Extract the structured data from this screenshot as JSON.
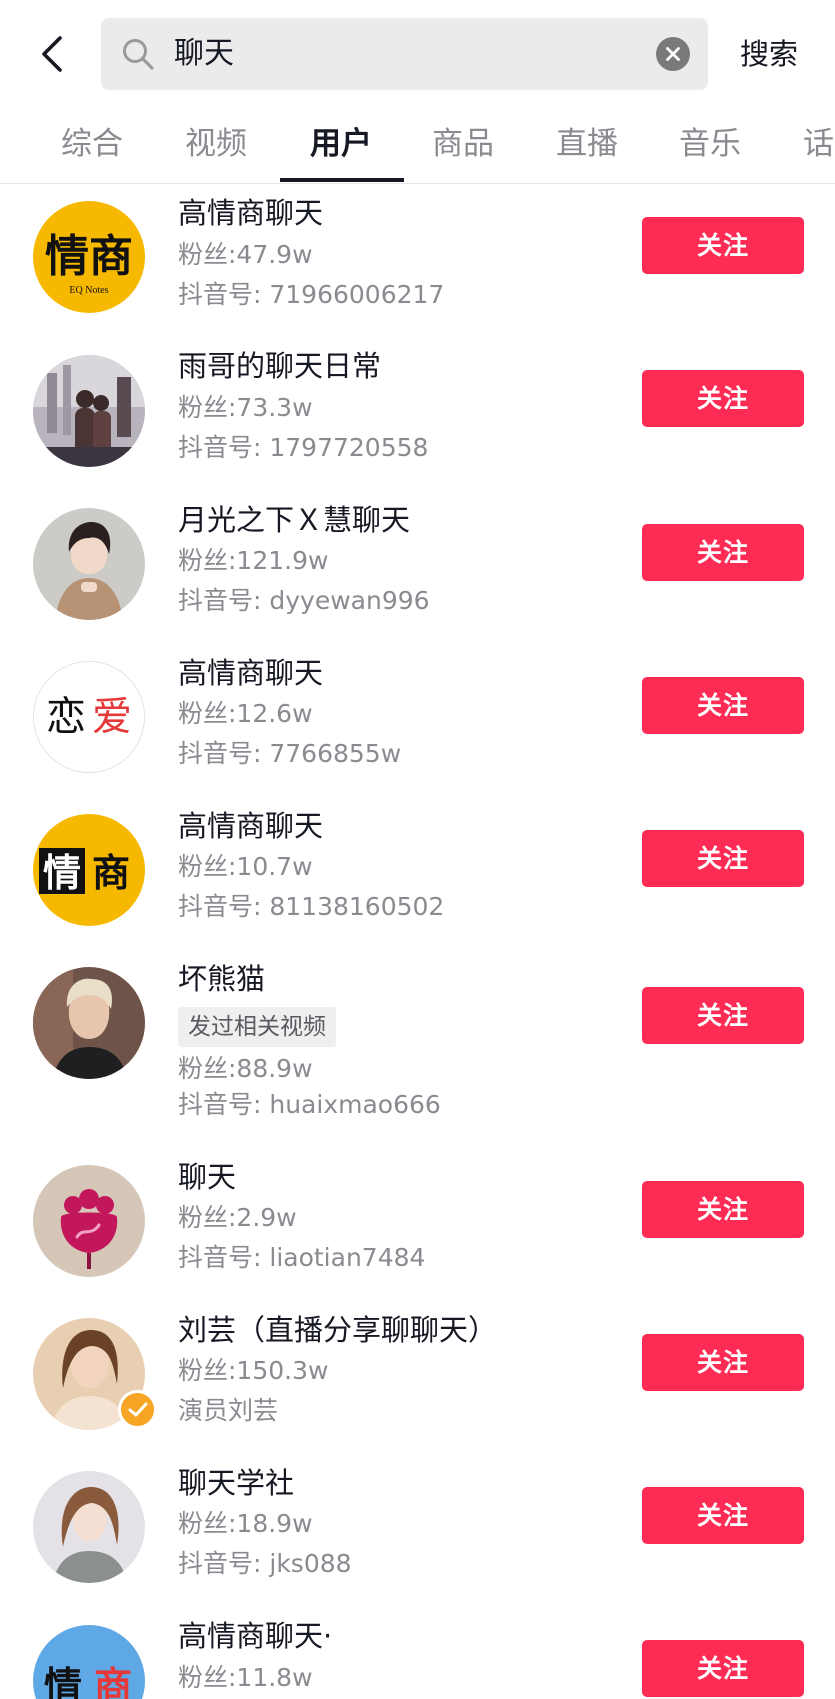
{
  "header": {
    "query": "聊天",
    "search_button": "搜索"
  },
  "tabs": [
    {
      "label": "综合",
      "active": false
    },
    {
      "label": "视频",
      "active": false
    },
    {
      "label": "用户",
      "active": true
    },
    {
      "label": "商品",
      "active": false
    },
    {
      "label": "直播",
      "active": false
    },
    {
      "label": "音乐",
      "active": false
    },
    {
      "label": "话",
      "active": false
    }
  ],
  "users": [
    {
      "name": "高情商聊天",
      "fans": "粉丝:47.9w",
      "id": "抖音号: 71966006217",
      "follow": "关注",
      "avatar_text": "情商",
      "avatar_sub": "EQ Notes"
    },
    {
      "name": "雨哥的聊天日常",
      "fans": "粉丝:73.3w",
      "id": "抖音号: 1797720558",
      "follow": "关注"
    },
    {
      "name": "月光之下Ｘ慧聊天",
      "fans": "粉丝:121.9w",
      "id": "抖音号: dyyewan996",
      "follow": "关注"
    },
    {
      "name": "高情商聊天",
      "fans": "粉丝:12.6w",
      "id": "抖音号: 7766855w",
      "follow": "关注",
      "avatar_text_1": "恋",
      "avatar_text_2": "爱"
    },
    {
      "name": "高情商聊天",
      "fans": "粉丝:10.7w",
      "id": "抖音号: 81138160502",
      "follow": "关注",
      "avatar_text_1": "情",
      "avatar_text_2": "商"
    },
    {
      "name": "坏熊猫",
      "tag": "发过相关视频",
      "fans": "粉丝:88.9w",
      "id": "抖音号: huaixmao666",
      "follow": "关注"
    },
    {
      "name": "聊天",
      "fans": "粉丝:2.9w",
      "id": "抖音号: liaotian7484",
      "follow": "关注"
    },
    {
      "name": "刘芸（直播分享聊聊天）",
      "fans": "粉丝:150.3w",
      "id": "演员刘芸",
      "follow": "关注",
      "verified": true
    },
    {
      "name": "聊天学社",
      "fans": "粉丝:18.9w",
      "id": "抖音号: jks088",
      "follow": "关注"
    },
    {
      "name": "高情商聊天·",
      "fans": "粉丝:11.8w",
      "follow": "关注",
      "avatar_text_1": "情",
      "avatar_text_2": "商"
    }
  ],
  "colors": {
    "accent": "#fe2c55",
    "primary_text": "#161823",
    "secondary_text": "#8a8b91",
    "search_bg": "#ebebeb",
    "verified": "#f6a624"
  }
}
